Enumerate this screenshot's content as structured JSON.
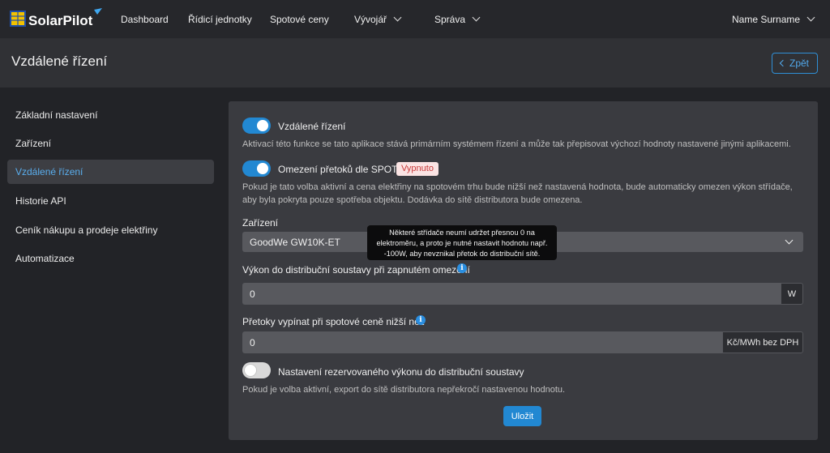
{
  "brand": {
    "name": "SolarPilot"
  },
  "nav": {
    "dashboard": "Dashboard",
    "control_units": "Řídicí jednotky",
    "spot_prices": "Spotové ceny",
    "developer": "Vývojář",
    "admin": "Správa",
    "user": "Name Surname"
  },
  "page": {
    "title": "Vzdálené řízení",
    "back_label": "Zpět"
  },
  "sidebar": {
    "items": [
      {
        "label": "Základní nastavení"
      },
      {
        "label": "Zařízení"
      },
      {
        "label": "Vzdálené řízení",
        "active": true
      },
      {
        "label": "Historie API"
      },
      {
        "label": "Ceník nákupu a prodeje elektřiny"
      },
      {
        "label": "Automatizace"
      }
    ]
  },
  "settings": {
    "remote_control": {
      "label": "Vzdálené řízení",
      "enabled": true,
      "help": "Aktivací této funkce se tato aplikace stává primárním systémem řízení a může tak přepisovat výchozí hodnoty nastavené jinými aplikacemi."
    },
    "overflow_limit": {
      "label": "Omezení přetoků dle SPOTu",
      "enabled": true,
      "badge": "Vypnuto",
      "help_line1": "Pokud je tato volba aktivní a cena elektřiny na spotovém trhu bude nižší než nastavená hodnota, bude automaticky omezen výkon střídače,",
      "help_line2": "aby byla pokryta pouze spotřeba objektu. Dodávka do sítě distributora bude omezena."
    },
    "device": {
      "label": "Zařízení",
      "value": "GoodWe GW10K-ET"
    },
    "grid_power": {
      "label": "Výkon do distribuční soustavy při zapnutém omezení",
      "value": "0",
      "unit": "W"
    },
    "price_threshold": {
      "label": "Přetoky vypínat při spotové ceně nižší než",
      "value": "0",
      "unit": "Kč/MWh bez DPH"
    },
    "reserved_power": {
      "label": "Nastavení rezervovaného výkonu do distribuční soustavy",
      "enabled": false,
      "help": "Pokud je volba aktivní, export do sítě distributora nepřekročí nastavenou hodnotu."
    },
    "tooltip": {
      "line1": "Některé střídače neumí udržet přesnou 0 na",
      "line2": "elektroměru, a proto je nutné nastavit hodnotu např.",
      "line3": "-100W, aby nevznikal přetok do distribuční sítě."
    },
    "save_label": "Uložit"
  },
  "colors": {
    "accent": "#2288d2",
    "badge_bg": "#fbe4e4",
    "badge_text": "#c83a3a"
  }
}
